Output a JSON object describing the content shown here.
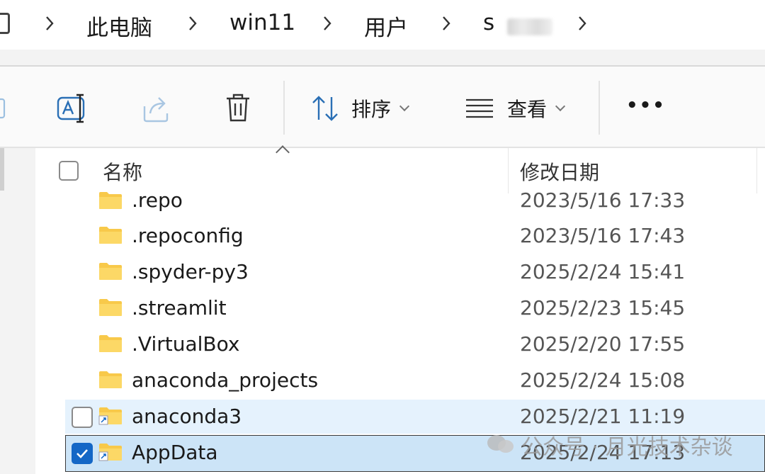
{
  "breadcrumb": {
    "items": [
      "此电脑",
      "win11",
      "用户",
      "s"
    ]
  },
  "toolbar": {
    "sort_label": "排序",
    "view_label": "查看",
    "more_label": "•••"
  },
  "columns": {
    "name": "名称",
    "modified": "修改日期"
  },
  "rows": [
    {
      "name": ".repo",
      "date": "2023/5/16 17:33"
    },
    {
      "name": ".repoconfig",
      "date": "2023/5/16 17:43"
    },
    {
      "name": ".spyder-py3",
      "date": "2025/2/24 15:41"
    },
    {
      "name": ".streamlit",
      "date": "2025/2/23 15:45"
    },
    {
      "name": ".VirtualBox",
      "date": "2025/2/20 17:55"
    },
    {
      "name": "anaconda_projects",
      "date": "2025/2/24 15:08"
    },
    {
      "name": "anaconda3",
      "date": "2025/2/21 11:19"
    },
    {
      "name": "AppData",
      "date": "2025/2/24 17:13"
    }
  ],
  "watermark": "公众号 · 月光技术杂谈",
  "colors": {
    "folder": "#f8c94a",
    "selection": "#cce4f7",
    "hover": "#e5f2fd",
    "accent": "#1467c6"
  }
}
